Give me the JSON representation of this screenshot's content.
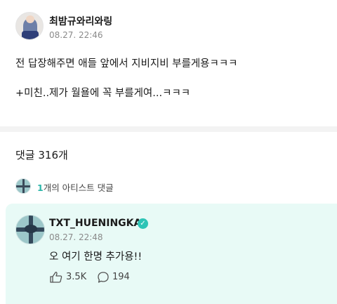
{
  "post": {
    "author": "최밤규와리와링",
    "timestamp": "08.27. 22:46",
    "line1": "전 답장해주면 애들 앞에서 지비지비 부를게용ㅋㅋㅋ",
    "line2": "+미친..제가 월욜에 꼭 부를게여...ㅋㅋㅋ"
  },
  "comments": {
    "title": "댓글 316개"
  },
  "artist_filter": {
    "count": "1",
    "label": "개의 아티스트 댓글"
  },
  "comment": {
    "author": "TXT_HUENINGKAI",
    "verified_mark": "✓",
    "timestamp": "08.27. 22:48",
    "text": "오 여기 한명 추가용!!",
    "likes": "3.5K",
    "replies": "194"
  },
  "icons": {
    "verified": "verified-badge-icon",
    "like": "like-icon",
    "reply": "reply-icon"
  },
  "colors": {
    "accent": "#2ab5a8",
    "comment_bg": "#e8faf6",
    "verified": "#2ec4b6"
  }
}
